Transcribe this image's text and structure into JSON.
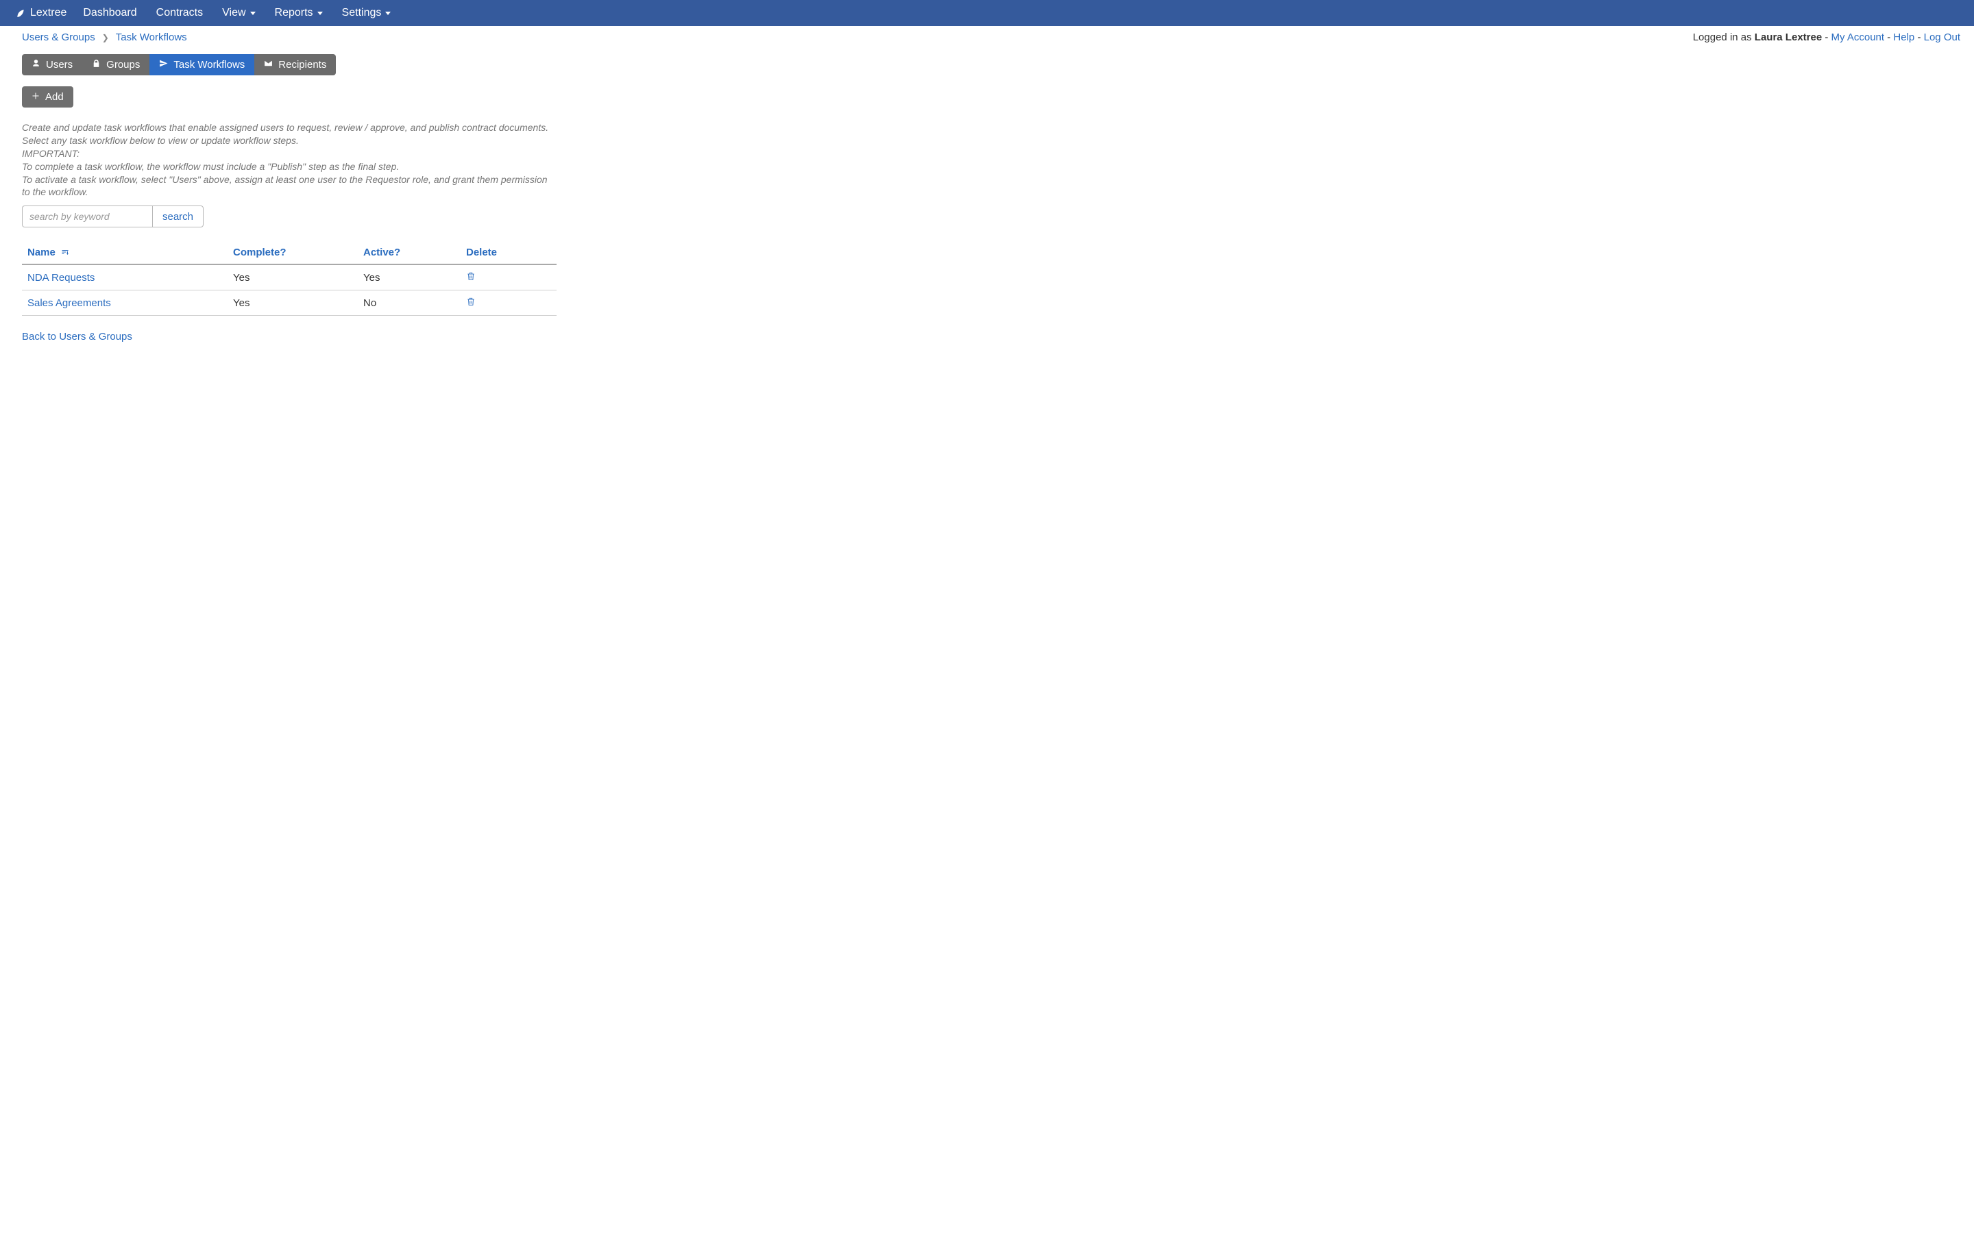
{
  "brand": "Lextree",
  "nav": {
    "dashboard": "Dashboard",
    "contracts": "Contracts",
    "view": "View",
    "reports": "Reports",
    "settings": "Settings"
  },
  "breadcrumb": {
    "root": "Users & Groups",
    "current": "Task Workflows"
  },
  "account": {
    "prefix": "Logged in as ",
    "user": "Laura Lextree",
    "my_account": "My Account",
    "help": "Help",
    "logout": "Log Out"
  },
  "tabs": {
    "users": "Users",
    "groups": "Groups",
    "workflows": "Task Workflows",
    "recipients": "Recipients"
  },
  "add_label": "Add",
  "description": {
    "line1": "Create and update task workflows that enable assigned users to request, review / approve, and publish contract documents. Select any task workflow below to view or update workflow steps.",
    "line2": "IMPORTANT:",
    "line3": "To complete a task workflow, the workflow must include a \"Publish\" step as the final step.",
    "line4": "To activate a task workflow, select \"Users\" above, assign at least one user to the Requestor role, and grant them permission to the workflow."
  },
  "search": {
    "placeholder": "search by keyword",
    "button": "search"
  },
  "columns": {
    "name": "Name",
    "complete": "Complete?",
    "active": "Active?",
    "delete": "Delete"
  },
  "rows": [
    {
      "name": "NDA Requests",
      "complete": "Yes",
      "active": "Yes"
    },
    {
      "name": "Sales Agreements",
      "complete": "Yes",
      "active": "No"
    }
  ],
  "back_link": "Back to Users & Groups"
}
